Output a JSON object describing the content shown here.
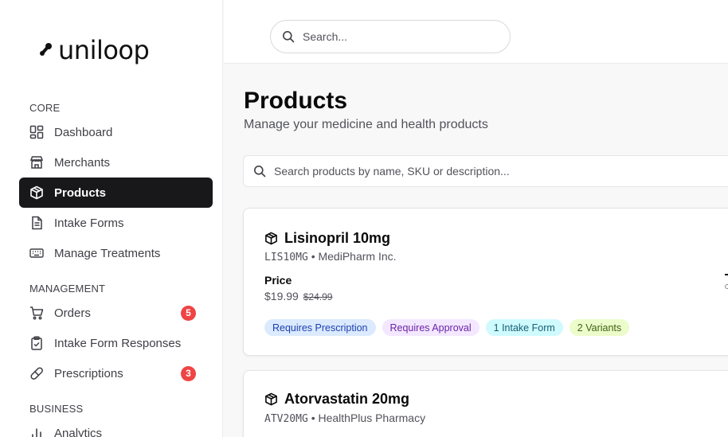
{
  "brand": {
    "name": "uniloop"
  },
  "sidebar": {
    "sections": [
      {
        "label": "CORE"
      },
      {
        "label": "MANAGEMENT"
      },
      {
        "label": "BUSINESS"
      }
    ],
    "items": [
      {
        "label": "Dashboard",
        "icon": "dashboard-icon"
      },
      {
        "label": "Merchants",
        "icon": "store-icon"
      },
      {
        "label": "Products",
        "icon": "package-icon",
        "active": true
      },
      {
        "label": "Intake Forms",
        "icon": "file-text-icon"
      },
      {
        "label": "Manage Treatments",
        "icon": "keyboard-icon"
      },
      {
        "label": "Orders",
        "icon": "cart-icon",
        "badge": "5"
      },
      {
        "label": "Intake Form Responses",
        "icon": "clipboard-check-icon"
      },
      {
        "label": "Prescriptions",
        "icon": "pill-icon",
        "badge": "3"
      },
      {
        "label": "Analytics",
        "icon": "bar-chart-icon"
      }
    ]
  },
  "topbar": {
    "search_placeholder": "Search..."
  },
  "page": {
    "title": "Products",
    "subtitle": "Manage your medicine and health products",
    "search_placeholder": "Search products by name, SKU or description..."
  },
  "products": [
    {
      "name": "Lisinopril 10mg",
      "sku": "LIS10MG",
      "separator": "•",
      "merchant": "MediPharm Inc.",
      "price_label": "Price",
      "price": "$19.99",
      "old_price": "$24.99",
      "tags": [
        {
          "label": "Requires Prescription",
          "bg": "#dbeafe",
          "fg": "#1e40af"
        },
        {
          "label": "Requires Approval",
          "bg": "#f3e8ff",
          "fg": "#6b21a8"
        },
        {
          "label": "1 Intake Form",
          "bg": "#cffafe",
          "fg": "#155e75"
        },
        {
          "label": "2 Variants",
          "bg": "#ecfccb",
          "fg": "#3f6212"
        }
      ]
    },
    {
      "name": "Atorvastatin 20mg",
      "sku": "ATV20MG",
      "separator": "•",
      "merchant": "HealthPlus Pharmacy"
    }
  ],
  "colors": {
    "active_nav_bg": "#18181b",
    "badge_bg": "#ef4444"
  }
}
